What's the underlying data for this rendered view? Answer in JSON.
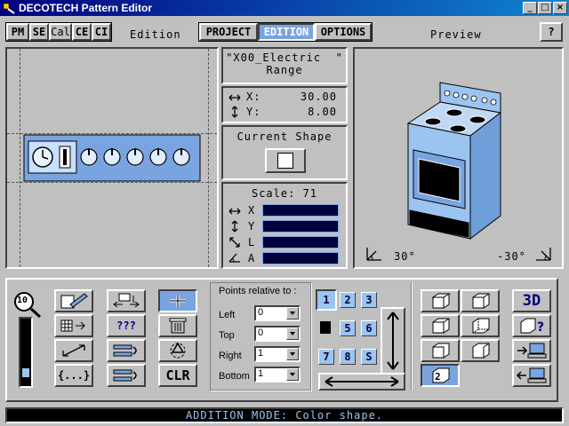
{
  "window": {
    "title": "DECOTECH Pattern Editor",
    "min_label": "_",
    "max_label": "□",
    "close_label": "×"
  },
  "toolbar": {
    "module_buttons": [
      "PM",
      "SE",
      "Cal",
      "CE",
      "CI"
    ],
    "section_label": "Edition",
    "tabs": [
      "PROJECT",
      "EDITION",
      "OPTIONS"
    ],
    "active_tab": "EDITION",
    "preview_label": "Preview",
    "help_label": "?"
  },
  "info": {
    "pattern_name": "\"X00_Electric  \"",
    "pattern_sub": "Range",
    "x_label": "X:",
    "x_value": "30.00",
    "y_label": "Y:",
    "y_value": "8.00",
    "current_shape_label": "Current Shape",
    "scale_label": "Scale: 71",
    "scale_rows": [
      "X",
      "Y",
      "L",
      "A"
    ]
  },
  "preview": {
    "angle_left": "30°",
    "angle_right": "-30°"
  },
  "zoom": {
    "value": "10",
    "level": 0.25
  },
  "tools": {
    "clr_label": "CLR",
    "braces_label": "{...}",
    "question_label": "???"
  },
  "points": {
    "legend": "Points relative to :",
    "rows": [
      {
        "label": "Left",
        "value": "0"
      },
      {
        "label": "Top",
        "value": "0"
      },
      {
        "label": "Right",
        "value": "1"
      },
      {
        "label": "Bottom",
        "value": "1"
      }
    ]
  },
  "numpad": {
    "keys": [
      "1",
      "2",
      "3",
      "5",
      "6",
      "7",
      "8",
      "S"
    ],
    "active": "1"
  },
  "views": {
    "three_d_label": "3D",
    "selected_view": "2"
  },
  "status": {
    "message": "ADDITION MODE: Color shape."
  },
  "colors": {
    "accent": "#7aa4e0",
    "light_accent": "#9cc4f0",
    "title_bar": "#000080",
    "panel": "#c0c0c0"
  }
}
